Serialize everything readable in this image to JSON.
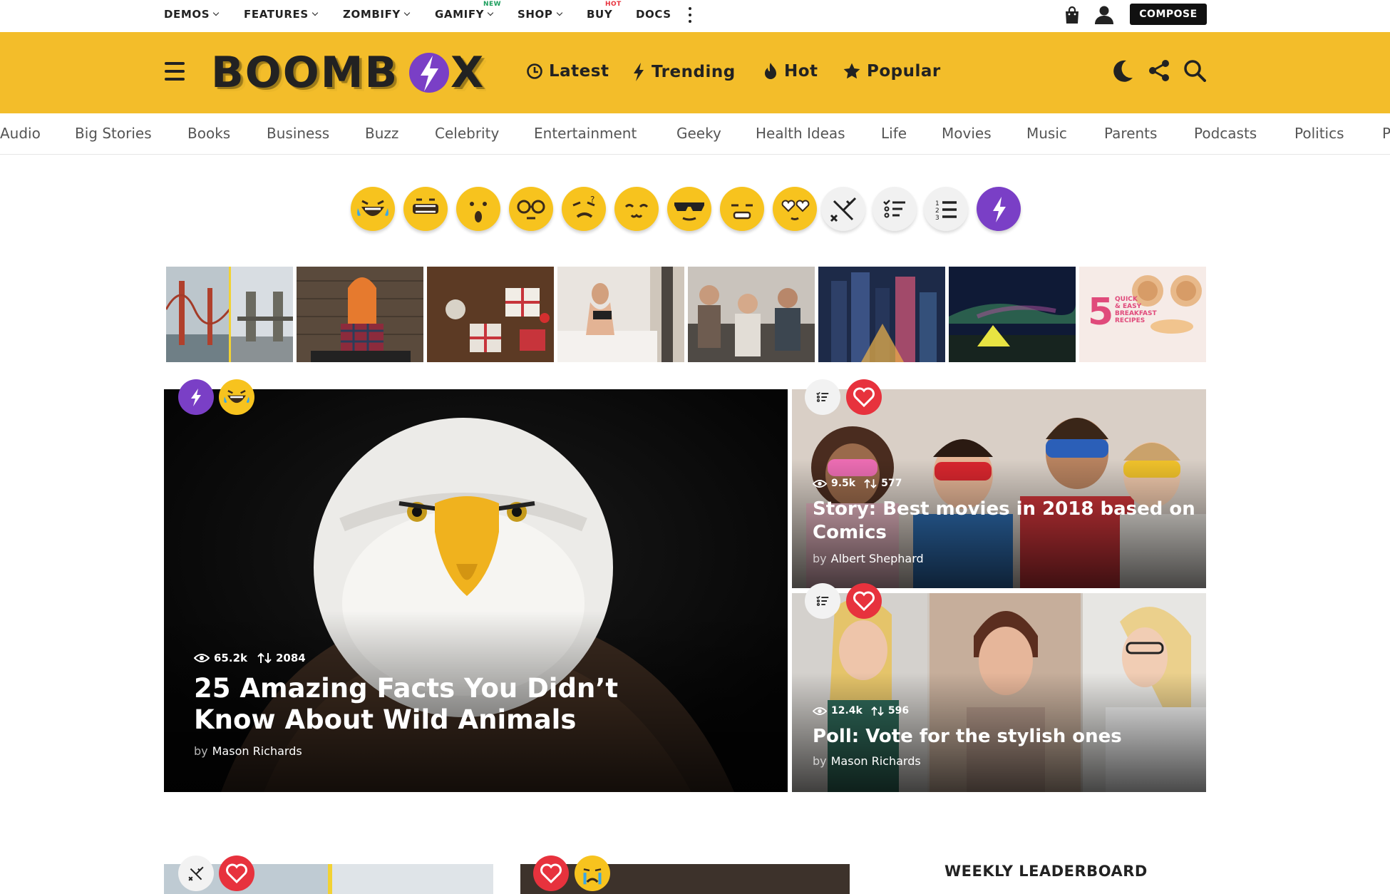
{
  "topnav": {
    "items": [
      {
        "label": "DEMOS",
        "dropdown": true
      },
      {
        "label": "FEATURES",
        "dropdown": true
      },
      {
        "label": "ZOMBIFY",
        "dropdown": true
      },
      {
        "label": "GAMIFY",
        "dropdown": true,
        "tag": "NEW"
      },
      {
        "label": "SHOP",
        "dropdown": true
      },
      {
        "label": "BUY",
        "dropdown": false,
        "tag": "HOT"
      },
      {
        "label": "DOCS",
        "dropdown": false
      }
    ],
    "compose_label": "COMPOSE",
    "icons": [
      "more-icon",
      "shopping-bag-icon",
      "user-icon"
    ]
  },
  "header": {
    "brand": "BOOMBOX",
    "nav": [
      {
        "label": "Latest",
        "icon": "clock-icon"
      },
      {
        "label": "Trending",
        "icon": "bolt-icon"
      },
      {
        "label": "Hot",
        "icon": "flame-icon"
      },
      {
        "label": "Popular",
        "icon": "star-icon"
      }
    ],
    "icons": [
      "menu-icon",
      "moon-icon",
      "share-icon",
      "search-icon"
    ],
    "background": "#f3bd2a"
  },
  "categories": [
    "Audio",
    "Big Stories",
    "Books",
    "Business",
    "Buzz",
    "Celebrity",
    "Entertainment",
    "Geeky",
    "Health Ideas",
    "Life",
    "Movies",
    "Music",
    "Parents",
    "Podcasts",
    "Politics",
    "P"
  ],
  "reactions": [
    "lol",
    "omg",
    "wow",
    "geeky",
    "confused",
    "cute",
    "cool",
    "fail",
    "love",
    "versus",
    "list",
    "numbered-list",
    "trending"
  ],
  "thumbnails": [
    "bridges",
    "dj-girl",
    "gift-boxes",
    "woman-on-bed",
    "party-friends",
    "city-night",
    "northern-lights-tent",
    "breakfast-recipes"
  ],
  "thumb_text": {
    "number": "5",
    "line1": "QUICK",
    "line2": "& EASY",
    "line3": "BREAKFAST",
    "line4": "RECIPES"
  },
  "featured": {
    "views": "65.2k",
    "shares": "2084",
    "title": "25 Amazing Facts You Didn’t Know About Wild Animals",
    "by_label": "by",
    "author": "Mason Richards"
  },
  "side_posts": [
    {
      "views": "9.5k",
      "shares": "577",
      "title": "Story: Best movies in 2018 based on Comics",
      "by_label": "by",
      "author": "Albert Shephard"
    },
    {
      "views": "12.4k",
      "shares": "596",
      "title": "Poll: Vote for the stylish ones",
      "by_label": "by",
      "author": "Mason Richards"
    }
  ],
  "leaderboard_title": "WEEKLY LEADERBOARD",
  "colors": {
    "accent": "#f3bd2a",
    "purple": "#7a3fc6",
    "heart": "#e7323d"
  }
}
